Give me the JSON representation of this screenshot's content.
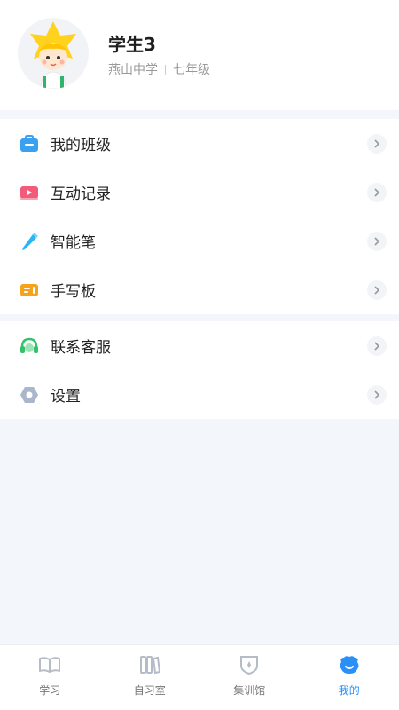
{
  "profile": {
    "name": "学生3",
    "school": "燕山中学",
    "grade": "七年级"
  },
  "menu_group1": [
    {
      "label": "我的班级",
      "icon": "class-icon",
      "color": "#3aa0f0"
    },
    {
      "label": "互动记录",
      "icon": "video-record-icon",
      "color": "#f25c7a"
    },
    {
      "label": "智能笔",
      "icon": "smart-pen-icon",
      "color": "#29b6f6"
    },
    {
      "label": "手写板",
      "icon": "tablet-icon",
      "color": "#f7a21b"
    }
  ],
  "menu_group2": [
    {
      "label": "联系客服",
      "icon": "headset-icon",
      "color": "#33c26a"
    },
    {
      "label": "设置",
      "icon": "settings-icon",
      "color": "#8c9bb5"
    }
  ],
  "tabs": [
    {
      "label": "学习",
      "icon": "book-icon",
      "active": false
    },
    {
      "label": "自习室",
      "icon": "study-room-icon",
      "active": false
    },
    {
      "label": "集训馆",
      "icon": "training-icon",
      "active": false
    },
    {
      "label": "我的",
      "icon": "profile-icon",
      "active": true
    }
  ],
  "colors": {
    "accent": "#2a8ff7",
    "background": "#f3f6fb"
  }
}
